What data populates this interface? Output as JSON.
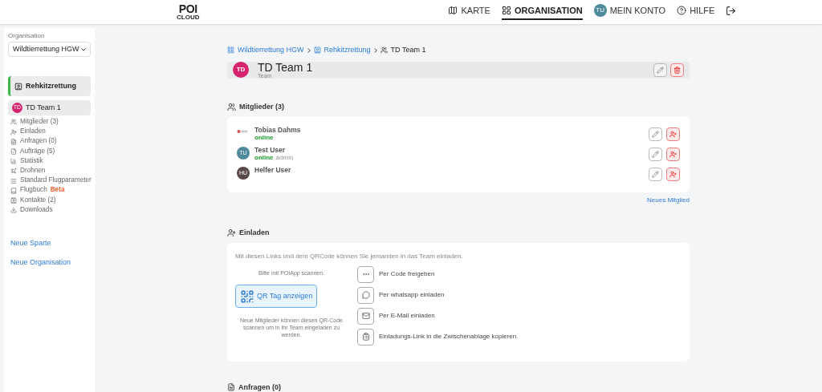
{
  "logo": {
    "top": "POI",
    "bottom": "CLOUD"
  },
  "nav": [
    {
      "label": "KARTE",
      "selected": false,
      "kind": "map"
    },
    {
      "label": "ORGANISATION",
      "selected": true,
      "kind": "org"
    },
    {
      "label": "MEIN KONTO",
      "selected": false,
      "kind": "avatar",
      "initials": "TU"
    },
    {
      "label": "HILFE",
      "selected": false,
      "kind": "help"
    },
    {
      "kind": "logout",
      "selected": false
    }
  ],
  "sidebar": {
    "org_label": "Organisation",
    "org_value": "Wildtierrettung HGW",
    "section": "Rehkitzrettung",
    "team": {
      "initials": "TD",
      "name": "TD Team 1",
      "selected": true
    },
    "items": [
      {
        "label": "Mitglieder (3)"
      },
      {
        "label": "Einladen"
      },
      {
        "label": "Anfragen (0)"
      },
      {
        "label": "Aufträge (5)"
      },
      {
        "label": "Statistik"
      },
      {
        "label": "Drohnen"
      },
      {
        "label": "Standard Flugparameter"
      },
      {
        "label": "Flugbuch",
        "badge": "Beta"
      },
      {
        "label": "Kontakte (2)"
      },
      {
        "label": "Downloads"
      }
    ],
    "links": [
      "Neue Sparte",
      "Neue Organisation"
    ]
  },
  "breadcrumb": [
    "Wildtierrettung HGW",
    "Rehkitzrettung",
    "TD Team 1"
  ],
  "header": {
    "initials": "TD",
    "title": "TD Team 1",
    "subtitle": "Team"
  },
  "members": {
    "title": "Mitglieder (3)",
    "rows": [
      {
        "name": "Tobias Dahms",
        "status": "online"
      },
      {
        "name": "Test User",
        "status": "online",
        "role": "admin",
        "avatar": {
          "kind": "initials",
          "initials": "TU",
          "color": "#4e8a9c"
        }
      },
      {
        "name": "Helfer User",
        "avatar": {
          "kind": "initials",
          "initials": "HU",
          "color": "#5a4848"
        }
      }
    ],
    "new_link": "Neues Mitglied"
  },
  "invite": {
    "title": "Einladen",
    "intro": "Mit diesen Links und dem QRCode können Sie jemanden in das Team einladen.",
    "qr_hint": "Bitte mit POIApp scannen.",
    "qr_button": "QR Tag anzeigen",
    "qr_note": "Neue Mitglieder können diesen QR-Code scannen um in Ihr Team eingeladen zu werden.",
    "actions": [
      {
        "kind": "code",
        "label": "Per Code freigeben"
      },
      {
        "kind": "whatsapp",
        "label": "Per whatsapp einladen"
      },
      {
        "kind": "email",
        "label": "Per E-Mail einladen"
      },
      {
        "kind": "clipboard",
        "label": "Einladungs-Link in die Zwischenablage kopieren."
      }
    ]
  },
  "requests": {
    "title": "Anfragen (0)"
  }
}
